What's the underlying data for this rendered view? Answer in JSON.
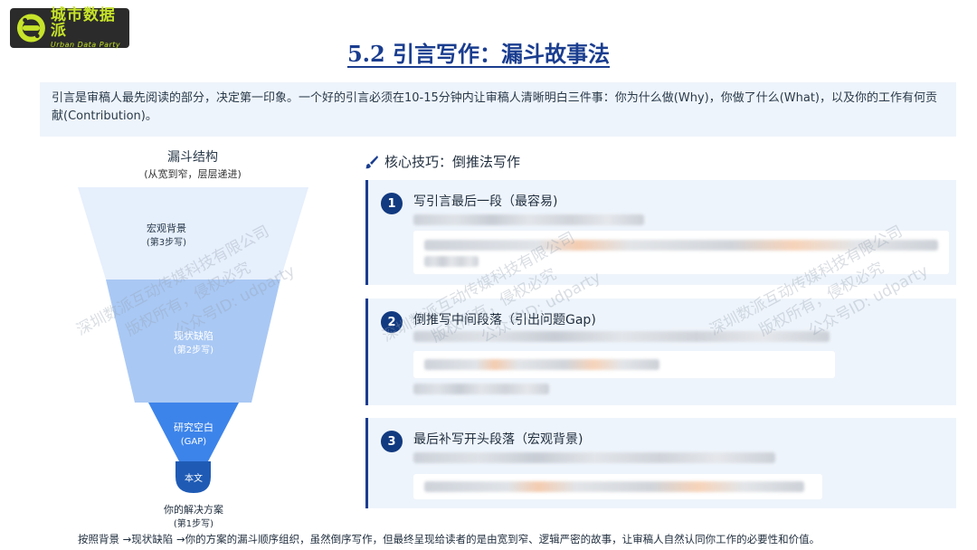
{
  "logo": {
    "name_cn": "城市数据派",
    "name_en": "Urban Data Party"
  },
  "title": "5.2 引言写作：漏斗故事法",
  "intro": "引言是审稿人最先阅读的部分，决定第一印象。一个好的引言必须在10-15分钟内让审稿人清晰明白三件事：你为什么做(Why)，你做了什么(What)，以及你的工作有何贡献(Contribution)。",
  "funnel": {
    "title": "漏斗结构",
    "subtitle": "(从宽到窄，层层递进)",
    "layers": [
      {
        "label": "宏观背景",
        "step": "(第3步写)",
        "color": "#e6effc"
      },
      {
        "label": "现状缺陷",
        "step": "(第2步写)",
        "color": "#a9c8f4"
      },
      {
        "label": "研究空白",
        "step": "(GAP)",
        "color": "#3d84ea"
      }
    ],
    "tip": {
      "label": "本文",
      "color": "#1f5bb5"
    },
    "solution": "你的解决方案",
    "solution_step": "(第1步写)"
  },
  "tips": {
    "header": "核心技巧：倒推法写作",
    "steps": [
      {
        "num": "1",
        "title": "写引言最后一段（最容易)"
      },
      {
        "num": "2",
        "title": "倒推写中间段落（引出问题Gap)"
      },
      {
        "num": "3",
        "title": "最后补写开头段落（宏观背景)"
      }
    ]
  },
  "bottom_note": "按照背景 →现状缺陷 →你的方案的漏斗顺序组织，虽然倒序写作，但最终呈现给读者的是由宽到窄、逻辑严密的故事，让审稿人自然认同你工作的必要性和价值。",
  "watermark": {
    "line1": "深圳数派互动传媒科技有限公司",
    "line2": "版权所有，侵权必究",
    "line3": "公众号ID: udparty"
  },
  "colors": {
    "accent": "#1a3d8f",
    "panel": "#eef4fb",
    "logo_green": "#c7e32a"
  }
}
